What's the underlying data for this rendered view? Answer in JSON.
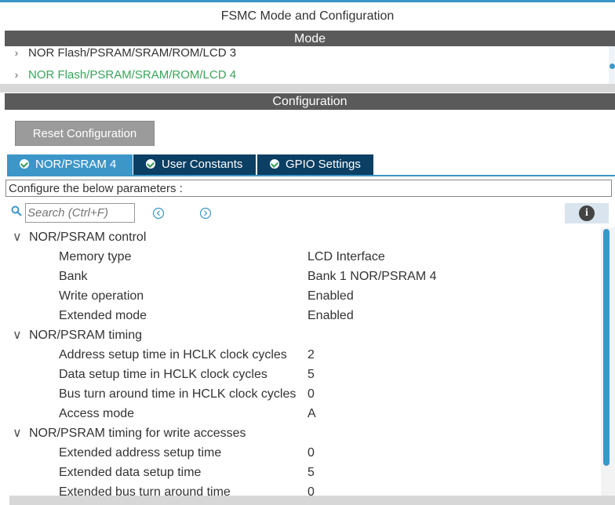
{
  "window_title": "FSMC Mode and Configuration",
  "mode_header": "Mode",
  "mode_items": [
    {
      "label": "NOR Flash/PSRAM/SRAM/ROM/LCD 3",
      "color": "#333333"
    },
    {
      "label": "NOR Flash/PSRAM/SRAM/ROM/LCD 4",
      "color": "#3aa35a"
    }
  ],
  "config_header": "Configuration",
  "reset_button": "Reset Configuration",
  "tabs": [
    {
      "label": "NOR/PSRAM 4",
      "active": true
    },
    {
      "label": "User Constants",
      "active": false
    },
    {
      "label": "GPIO Settings",
      "active": false
    }
  ],
  "params_caption": "Configure the below parameters :",
  "search": {
    "placeholder": "Search (Ctrl+F)"
  },
  "icons": {
    "search": "search-icon",
    "prev": "arrow-left-circle-icon",
    "next": "arrow-right-circle-icon",
    "info": "info-icon",
    "check": "check-circle-icon",
    "chevron": "chevron-icon"
  },
  "tree": {
    "groups": [
      {
        "title": "NOR/PSRAM control",
        "params": [
          {
            "label": "Memory type",
            "value": "LCD Interface"
          },
          {
            "label": "Bank",
            "value": "Bank 1 NOR/PSRAM 4"
          },
          {
            "label": "Write operation",
            "value": "Enabled"
          },
          {
            "label": "Extended mode",
            "value": "Enabled"
          }
        ]
      },
      {
        "title": "NOR/PSRAM timing",
        "params": [
          {
            "label": "Address setup time in HCLK clock cycles",
            "value": "2"
          },
          {
            "label": "Data setup time in HCLK clock cycles",
            "value": "5"
          },
          {
            "label": "Bus turn around time in HCLK clock cycles",
            "value": "0"
          },
          {
            "label": "Access mode",
            "value": "A"
          }
        ]
      },
      {
        "title": "NOR/PSRAM timing for write accesses",
        "params": [
          {
            "label": "Extended address setup time",
            "value": "0"
          },
          {
            "label": "Extended data setup time",
            "value": "5"
          },
          {
            "label": "Extended bus turn around time",
            "value": "0"
          }
        ]
      }
    ]
  },
  "colors": {
    "accent": "#3c96c8",
    "header_bg": "#5a5a5a",
    "tab_inactive": "#0b3f63",
    "selected_mode": "#3aa35a"
  }
}
